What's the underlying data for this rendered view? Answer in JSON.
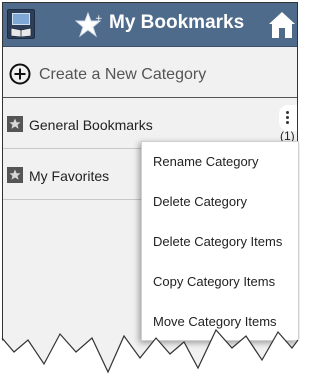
{
  "appbar": {
    "title": "My Bookmarks",
    "background": "#4f6b8c"
  },
  "create": {
    "label": "Create a New Category",
    "icon": "plus-circle-icon"
  },
  "categories": [
    {
      "label": "General Bookmarks",
      "count": "(1)",
      "icon": "star-icon"
    },
    {
      "label": "My Favorites",
      "icon": "star-icon"
    }
  ],
  "menu": {
    "items": [
      {
        "label": "Rename Category"
      },
      {
        "label": "Delete Category"
      },
      {
        "label": "Delete Category Items"
      },
      {
        "label": "Copy Category Items"
      },
      {
        "label": "Move Category Items"
      }
    ]
  }
}
